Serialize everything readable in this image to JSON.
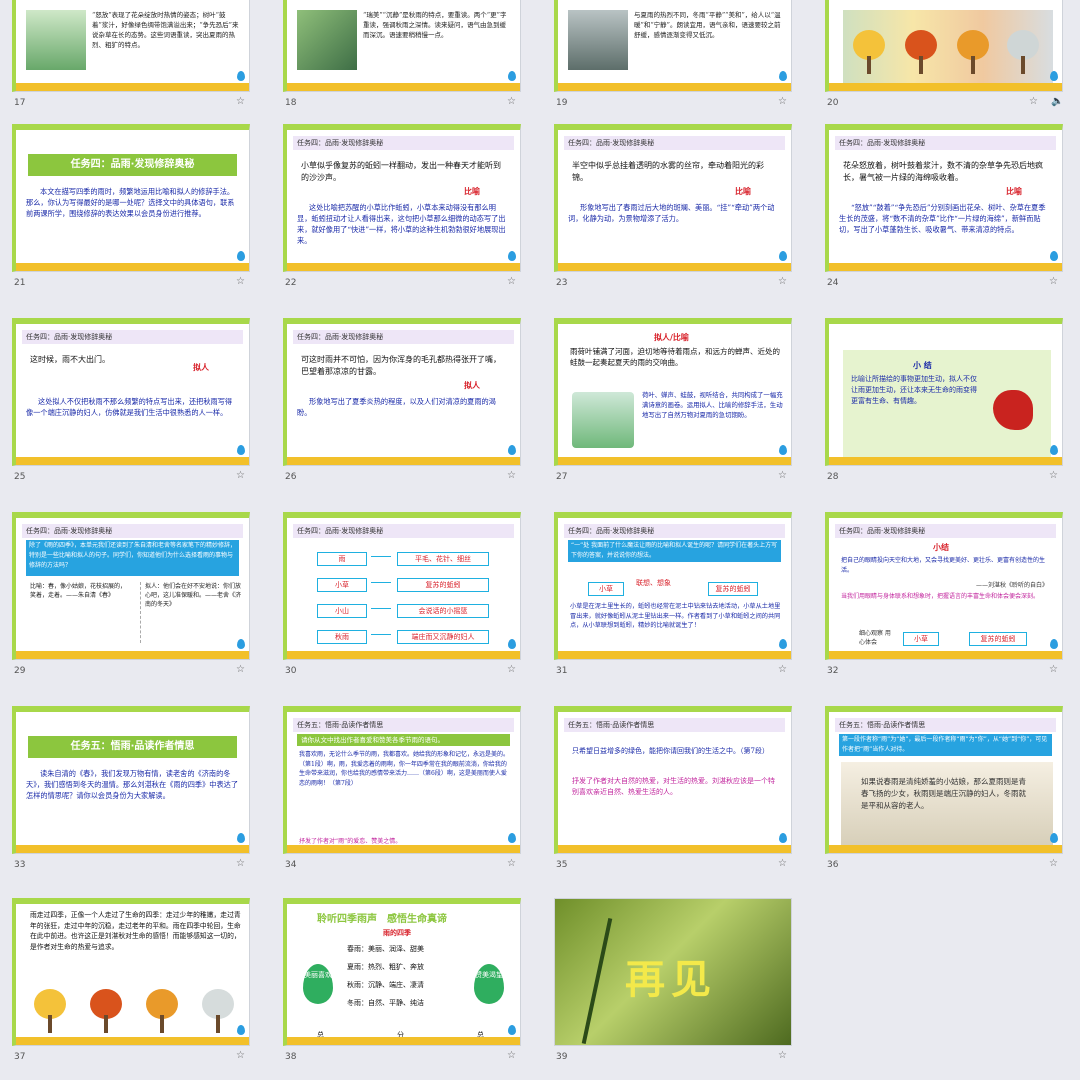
{
  "grid_rows": [
    {
      "cells": [
        {
          "num": "17",
          "text": "“怒放”表现了花朵绽放时热情的姿态；树叶“鼓着”浆汁，好像绿色绸带饱满溢出来；“争先恐后”来说杂草在长的态势。这些词语重读，突出夏雨的热烈、粗犷的特点。"
        },
        {
          "num": "18",
          "text": "“瑞美”“沉静”是秋雨的特点，要重读。两个“更”字重读，强调秋雨之深情。读来疑问，语气由急到缓而深沉。语速要稍稍慢一点。"
        },
        {
          "num": "19",
          "text": "与夏雨的热烈不同，冬雨“平静”“美和”，给人以“温暖”和“宁静”。朗读宜用，语气亲和，语速要较之前舒缓，感情逐渐变得又低沉。"
        },
        {
          "num": "20",
          "text": ""
        }
      ]
    },
    {
      "cells": [
        {
          "num": "21",
          "banner": "任务四：品雨·发现修辞奥秘",
          "text": "本文在描写四季的雨时，频繁地运用比喻和拟人的修辞手法。那么，你认为写得最好的是哪一处呢？选择文中的具体语句，联系前两课所学，围绕修辞的表达效果以会员身份进行推荐。"
        },
        {
          "num": "22",
          "header": "任务四：品雨·发现修辞奥秘",
          "quote": "小草似乎像复苏的蚯蚓一样翻动，发出一种春天才能听到的沙沙声。",
          "label": "比喻",
          "text": "这处比喻把苏醒的小草比作蚯蚓，小草本来动得没有那么明显，蚯蚓扭动才让人看得出来，这句把小草那么细微的动态写了出来，就好像用了“快进”一样，将小草的这种生机勃勃很好地展现出来。"
        },
        {
          "num": "23",
          "header": "任务四：品雨·发现修辞奥秘",
          "quote": "半空中似乎总挂着透明的水雾的丝帘，牵动着阳光的彩锦。",
          "label": "比喻",
          "text": "形象地写出了春雨过后大地的斑斓、美丽。“挂”“牵动”两个动词，化静为动，为景物增添了活力。"
        },
        {
          "num": "24",
          "header": "任务四：品雨·发现修辞奥秘",
          "quote": "花朵怒放着，树叶鼓着浆汁，数不清的杂草争先恐后地疯长，暑气被一片绿的海绵吸收着。",
          "label": "比喻",
          "text": "“怒放”“鼓着”“争先恐后”分别刻画出花朵、树叶、杂草在夏季生长的茂盛，将“数不清的杂草”比作“一片绿的海绵”，新鲜而贴切，写出了小草蓬勃生长、吸收暑气、带来清凉的特点。"
        }
      ]
    },
    {
      "cells": [
        {
          "num": "25",
          "header": "任务四：品雨·发现修辞奥秘",
          "quote": "这时候，雨不大出门。",
          "label": "拟人",
          "text": "这处拟人不仅把秋雨不那么频繁的特点写出来，还把秋雨写得像一个端庄沉静的妇人，仿佛就是我们生活中很熟悉的人一样。"
        },
        {
          "num": "26",
          "header": "任务四：品雨·发现修辞奥秘",
          "quote": "可这时雨并不可怕，因为你浑身的毛孔都热得张开了嘴，巴望着那凉凉的甘露。",
          "label": "拟人",
          "text": "形象地写出了夏季炎热的程度，以及人们对清凉的夏雨的渴盼。"
        },
        {
          "num": "27",
          "label": "拟人/比喻",
          "quote": "雨荷叶铺满了河面，迫切地等待着雨点，和远方的蝉声、近处的蛙鼓一起奏起夏天的雨的交响曲。",
          "text": "荷叶、蝉声、蛙鼓，视听结合，共同构成了一幅充满诗意的画卷。运用拟人、比喻的修辞手法，生动地写出了自然万物对夏雨的急切期盼。"
        },
        {
          "num": "28",
          "title": "小 结",
          "text": "比喻让所描绘的事物更加生动，拟人不仅让雨更加生动，还让本来无生命的雨变得更富有生命、有情趣。"
        }
      ]
    },
    {
      "cells": [
        {
          "num": "29",
          "header": "任务四：品雨·发现修辞奥秘",
          "bar": "除了《雨的四季》，本单元我们还读到了朱自清和老舍等名家笔下的精妙修辞，特别是一些比喻和拟人的句子。同学们，你知道他们为什么选择看雨的事物与修辞的方法吗？",
          "col1": "比喻：春，像小姑娘，花枝招展的，笑着，走着。——朱自清《春》",
          "col2": "拟人：他们会在好不安地说：你们放心吧，这儿准保暖和。——老舍《济南的冬天》"
        },
        {
          "num": "30",
          "header": "任务四：品雨·发现修辞奥秘",
          "pairs": [
            [
              "雨",
              "平毛、花针、细丝"
            ],
            [
              "小草",
              "复苏的蚯蚓"
            ],
            [
              "小山",
              "会说话的小摇篮"
            ],
            [
              "秋雨",
              "端庄而又沉静的妇人"
            ]
          ]
        },
        {
          "num": "31",
          "header": "任务四：品雨·发现修辞奥秘",
          "bar": "“一”处 我面前了什么魔法让雨的比喻和拟人诞生的呢？请同学们在著头上方写下你的答案，并说说你的想法。",
          "left": "小草",
          "mid": "联想、想象",
          "right": "复苏的蚯蚓",
          "text": "小草是在泥土里生长的，蚯蚓也经常在泥土中钻来钻去地活动，小草从土地里冒出来，就好像蚯蚓从泥土里钻出来一样。作者看到了小草和蚯蚓之间的共同点，从小草联想到蚯蚓，精妙的比喻就诞生了！"
        },
        {
          "num": "32",
          "header": "任务四：品雨·发现修辞奥秘",
          "title": "小结",
          "text": "把自己的眼睛投向天空和大地，又会寻找更美好、更壮乐、更富有创造性的生活。",
          "author": "——刘湛秋《聆听的自白》",
          "text2": "当我们用眼睛与身体联系和想象时，把握语言的丰富生命和体会便会深刻。",
          "left": "细心观察 用心体会",
          "mid": "小草",
          "right": "复苏的蚯蚓"
        }
      ]
    },
    {
      "cells": [
        {
          "num": "33",
          "banner": "任务五：悟雨·品读作者情思",
          "text": "读朱自清的《春》，我们发现万物有情，读老舍的《济南的冬天》，我们感悟到冬天的温情。那么刘湛秋在《雨的四季》中表达了怎样的情思呢？请你以会员身份为大家解读。"
        },
        {
          "num": "34",
          "header": "任务五：悟雨·品读作者情思",
          "bar": "请你从文中找出作者喜爱和赞美各季节雨的语句。",
          "text": "我喜欢雨，无论什么季节的雨，我都喜欢。她给我的形象和记忆，永远是美的。（第1段）啊，雨，我爱恋着的雨啊，你一年四季常在我的眼前流淌，你给我的生命带来滋润，你也给我的感情带来活力……（第6段）啊，这是美丽而使人爱恋的雨啊！（第7段）",
          "summary": "抒发了作者对“雨”的爱恋、赞美之情。"
        },
        {
          "num": "35",
          "header": "任务五：悟雨·品读作者情思",
          "text": "只希望日益增多的绿色，能把你请回我们的生活之中。（第7段）",
          "summary": "抒发了作者对大自然的热爱，对生活的热爱。刘湛秋应该是一个特别喜欢亲近自然、热爱生活的人。"
        },
        {
          "num": "36",
          "header": "任务五：悟雨·品读作者情思",
          "bar": "第一段作者称“雨”为“她”，最后一段作者称“雨”为“你”，从“她”到“你”，可见作者把“雨”当作人对待。",
          "text": "如果说春雨是清纯娇羞的小姑娘，那么夏雨则是青春飞扬的少女，秋雨则是端庄沉静的妇人，冬雨就是平和从容的老人。"
        }
      ]
    },
    {
      "cells": [
        {
          "num": "37",
          "text": "雨走过四季，正像一个人走过了生命的四季：走过少年的稚嫩，走过青年的张狂，走过中年的沉稳，走过老年的平和。雨在四季中轮回，生命在此中前进。也许这正是刘湛秋对生命的感悟！而能够感知这一切的，是作者对生命的热爱与追求。"
        },
        {
          "num": "38",
          "title": "聆听四季雨声　感悟生命真谛",
          "subtitle": "雨的四季",
          "left": "美丽喜欢",
          "right": "赞美渴望",
          "rows": [
            "春雨：美丽、润泽、甜美",
            "夏雨：热烈、粗犷、奔放",
            "秋雨：沉静、端庄、凄清",
            "冬雨：自然、平静、纯洁"
          ],
          "footer": [
            "总",
            "分",
            "总"
          ]
        },
        {
          "num": "39",
          "text": "再见"
        }
      ]
    }
  ],
  "icons": {
    "star": "star-icon",
    "speaker": "speaker-icon",
    "drop": "water-drop-icon"
  }
}
